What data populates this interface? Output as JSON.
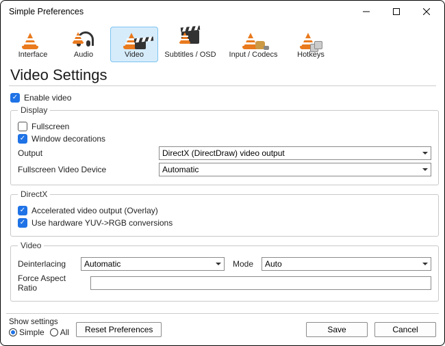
{
  "window": {
    "title": "Simple Preferences"
  },
  "tabs": {
    "interface": "Interface",
    "audio": "Audio",
    "video": "Video",
    "subtitles": "Subtitles / OSD",
    "input": "Input / Codecs",
    "hotkeys": "Hotkeys",
    "selected": "video"
  },
  "heading": "Video Settings",
  "enable_video": {
    "label": "Enable video",
    "checked": true
  },
  "display": {
    "legend": "Display",
    "fullscreen": {
      "label": "Fullscreen",
      "checked": false
    },
    "windowdeco": {
      "label": "Window decorations",
      "checked": true
    },
    "output": {
      "label": "Output",
      "value": "DirectX (DirectDraw) video output"
    },
    "fsdevice": {
      "label": "Fullscreen Video Device",
      "value": "Automatic"
    }
  },
  "directx": {
    "legend": "DirectX",
    "accel": {
      "label": "Accelerated video output (Overlay)",
      "checked": true
    },
    "yuv": {
      "label": "Use hardware YUV->RGB conversions",
      "checked": true
    }
  },
  "video": {
    "legend": "Video",
    "deint": {
      "label": "Deinterlacing",
      "value": "Automatic"
    },
    "mode": {
      "label": "Mode",
      "value": "Auto"
    },
    "aspect": {
      "label": "Force Aspect Ratio",
      "value": ""
    }
  },
  "footer": {
    "show_settings": "Show settings",
    "simple": "Simple",
    "all": "All",
    "selected": "simple",
    "reset": "Reset Preferences",
    "save": "Save",
    "cancel": "Cancel"
  }
}
